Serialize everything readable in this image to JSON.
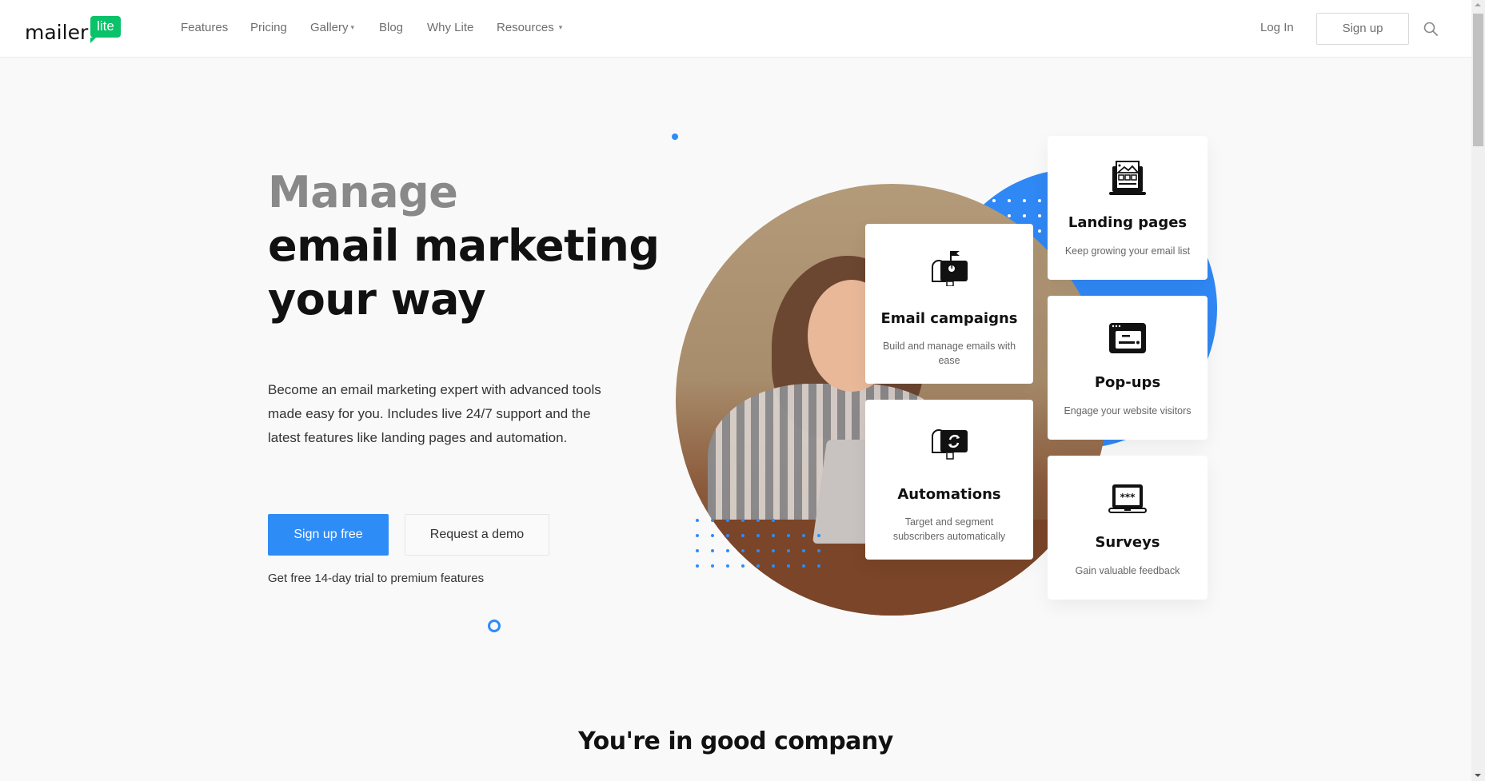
{
  "header": {
    "logo": {
      "word": "mailer",
      "badge": "lite",
      "badge_color": "#09c269"
    },
    "nav": [
      {
        "label": "Features",
        "has_dropdown": false
      },
      {
        "label": "Pricing",
        "has_dropdown": false
      },
      {
        "label": "Gallery",
        "has_dropdown": true
      },
      {
        "label": "Blog",
        "has_dropdown": false
      },
      {
        "label": "Why Lite",
        "has_dropdown": false
      },
      {
        "label": "Resources",
        "has_dropdown": true
      }
    ],
    "login_label": "Log In",
    "signup_label": "Sign up",
    "search_icon": "search-icon",
    "chevron": "⌄"
  },
  "hero": {
    "headline": [
      "Manage",
      "email marketing",
      "your way"
    ],
    "lead": "Become an email marketing expert with advanced tools made easy for you. Includes live 24/7 support and the latest features like landing pages and automation.",
    "primary_cta": "Sign up free",
    "secondary_cta": "Request a demo",
    "trial_note": "Get free 14-day trial to premium features",
    "accent_color": "#2e8cf7"
  },
  "features": [
    {
      "id": "email",
      "icon": "mailbox-flag-icon",
      "title": "Email campaigns",
      "desc": "Build and manage emails with ease"
    },
    {
      "id": "auto",
      "icon": "mailbox-refresh-icon",
      "title": "Automations",
      "desc": "Target and segment subscribers automatically"
    },
    {
      "id": "land",
      "icon": "laptop-landing-page-icon",
      "title": "Landing pages",
      "desc": "Keep growing your email list"
    },
    {
      "id": "pop",
      "icon": "browser-popup-icon",
      "title": "Pop-ups",
      "desc": "Engage your website visitors"
    },
    {
      "id": "surv",
      "icon": "laptop-survey-icon",
      "title": "Surveys",
      "desc": "Gain valuable feedback"
    }
  ],
  "next_section": {
    "title": "You're in good company"
  }
}
